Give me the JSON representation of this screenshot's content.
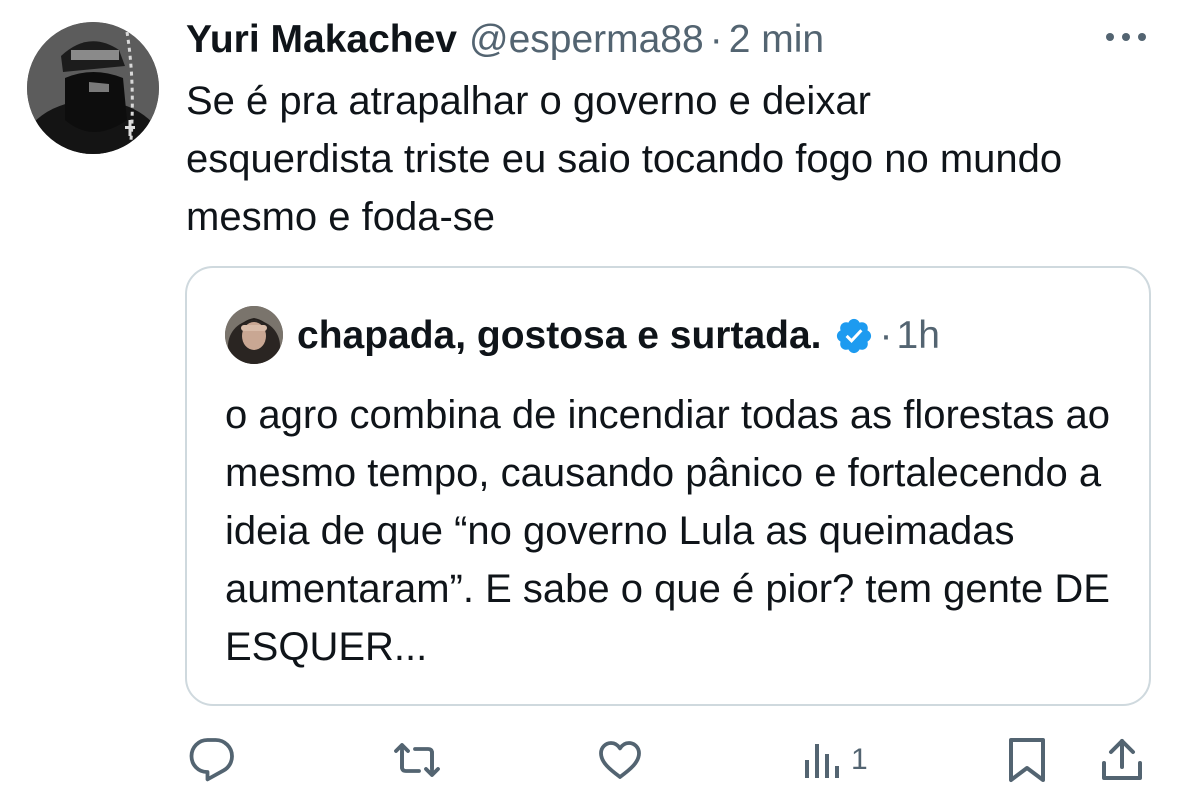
{
  "tweet": {
    "author_name": "Yuri Makachev",
    "author_handle": "@esperma88",
    "separator": "·",
    "time": "2 min",
    "text": "Se é pra atrapalhar o governo e deixar esquerdista triste eu saio tocando fogo no mundo mesmo e foda-se"
  },
  "quote": {
    "author_name": "chapada, gostosa e surtada.",
    "separator": "·",
    "time": "1h",
    "text": "o agro combina de incendiar todas as florestas ao mesmo tempo, causando pânico e fortalecendo a ideia de que “no governo Lula as queimadas aumentaram”. E sabe o que é pior? tem gente DE ESQUER..."
  },
  "actions": {
    "views_count": "1"
  },
  "colors": {
    "text": "#0f1419",
    "secondary": "#536471",
    "border": "#cfd9de",
    "verified": "#1d9bf0"
  },
  "icons": {
    "more": "more-dots-icon",
    "verified": "verified-badge-icon",
    "reply": "reply-icon",
    "retweet": "retweet-icon",
    "like": "heart-icon",
    "views": "views-chart-icon",
    "bookmark": "bookmark-icon",
    "share": "share-icon"
  }
}
